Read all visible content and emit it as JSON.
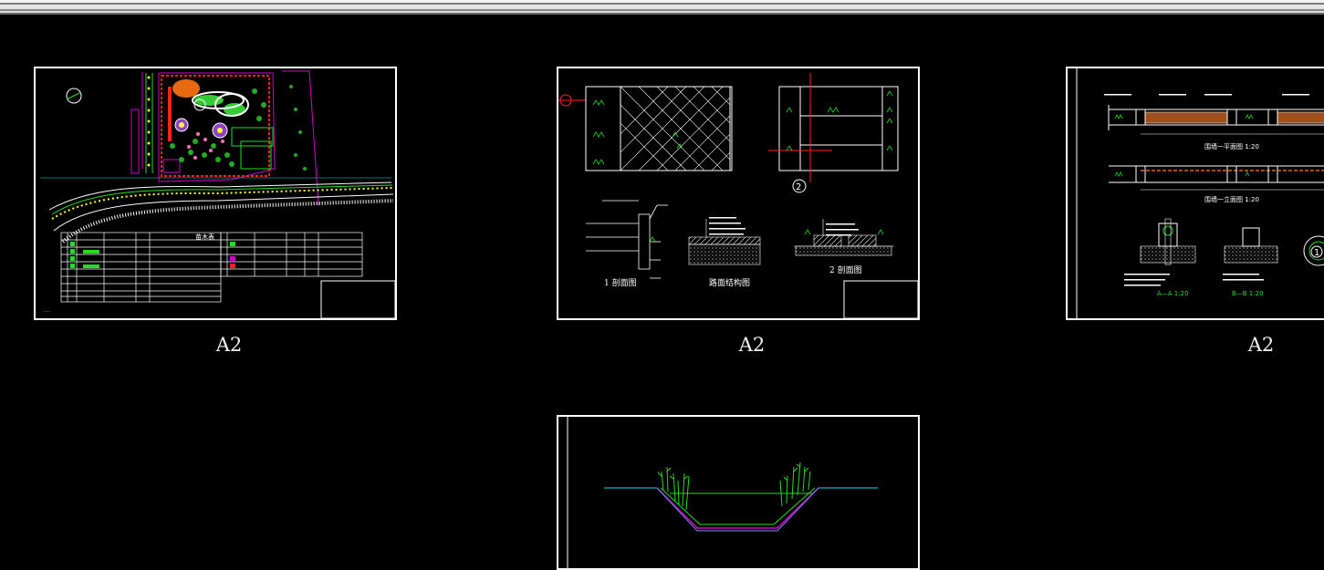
{
  "window": {
    "title_bar": ""
  },
  "sheets": [
    {
      "label": "A2",
      "drawing": "site-plan"
    },
    {
      "label": "A2",
      "drawing": "paving-details"
    },
    {
      "label": "A2",
      "drawing": "fence-details"
    },
    {
      "label": "",
      "drawing": "channel-section"
    }
  ],
  "sheet1": {
    "table_title": "苗木表"
  },
  "sheet2": {
    "caption_1": "1 剖面图",
    "caption_2": "路面结构图",
    "caption_3": "2 剖面图",
    "marker_2": "2"
  },
  "sheet3": {
    "caption_plan": "围墙一平面图 1:20",
    "caption_elev": "围墙一立面图 1:20",
    "caption_aa": "A—A 1:20",
    "caption_bb": "B—B 1:20",
    "marker_1": "1"
  },
  "colors": {
    "background": "#000000",
    "sheet_border": "#ffffff",
    "green": "#22dd22",
    "cyan": "#00e5e5",
    "magenta": "#d000d0",
    "red": "#ff2020",
    "yellow": "#ffff40",
    "brown": "#a0501e"
  }
}
